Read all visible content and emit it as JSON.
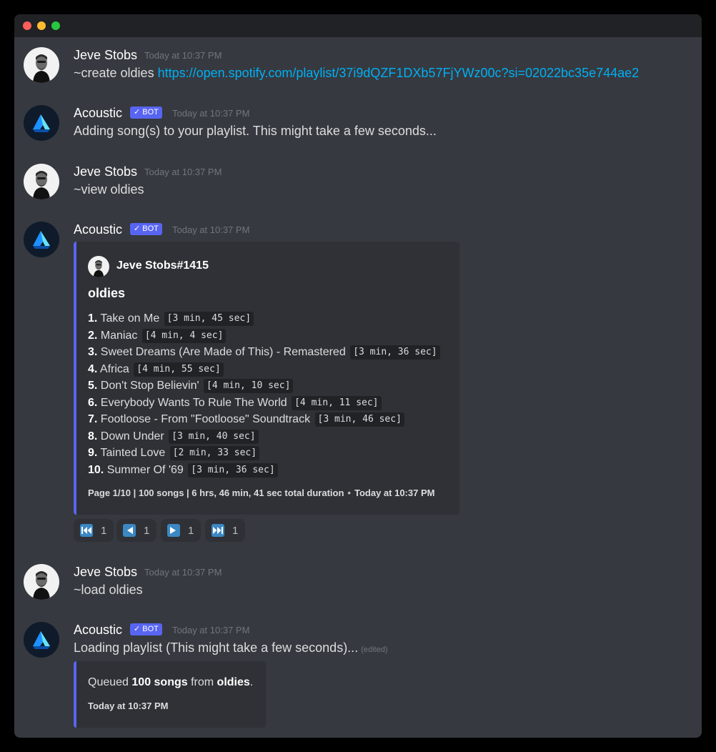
{
  "window": {
    "traffic_lights": [
      "close",
      "minimize",
      "maximize"
    ]
  },
  "users": {
    "jeve": {
      "name": "Jeve Stobs"
    },
    "acoustic": {
      "name": "Acoustic",
      "badge": "✓ BOT",
      "badge_color": "#5865f2"
    }
  },
  "messages": [
    {
      "author": "Jeve Stobs",
      "timestamp": "Today at 10:37 PM",
      "command": "~create oldies",
      "link": "https://open.spotify.com/playlist/37i9dQZF1DXb57FjYWz00c?si=02022bc35e744ae2"
    },
    {
      "author": "Acoustic",
      "badge": "✓ BOT",
      "timestamp": "Today at 10:37 PM",
      "text": "Adding song(s) to your playlist. This might take a few seconds..."
    },
    {
      "author": "Jeve Stobs",
      "timestamp": "Today at 10:37 PM",
      "text": "~view oldies"
    },
    {
      "author": "Acoustic",
      "badge": "✓ BOT",
      "timestamp": "Today at 10:37 PM"
    },
    {
      "author": "Jeve Stobs",
      "timestamp": "Today at 10:37 PM",
      "text": "~load oldies"
    },
    {
      "author": "Acoustic",
      "badge": "✓ BOT",
      "timestamp": "Today at 10:37 PM",
      "text": "Loading playlist (This might take a few seconds)...",
      "edited": "(edited)"
    }
  ],
  "playlist_embed": {
    "author": "Jeve Stobs#1415",
    "title": "oldies",
    "tracks": [
      {
        "num": "1.",
        "title": "Take on Me",
        "duration": "[3 min, 45 sec]"
      },
      {
        "num": "2.",
        "title": "Maniac",
        "duration": "[4 min, 4 sec]"
      },
      {
        "num": "3.",
        "title": "Sweet Dreams (Are Made of This) - Remastered",
        "duration": "[3 min, 36 sec]"
      },
      {
        "num": "4.",
        "title": "Africa",
        "duration": "[4 min, 55 sec]"
      },
      {
        "num": "5.",
        "title": "Don't Stop Believin'",
        "duration": "[4 min, 10 sec]"
      },
      {
        "num": "6.",
        "title": "Everybody Wants To Rule The World",
        "duration": "[4 min, 11 sec]"
      },
      {
        "num": "7.",
        "title": "Footloose - From \"Footloose\" Soundtrack",
        "duration": "[3 min, 46 sec]"
      },
      {
        "num": "8.",
        "title": "Down Under",
        "duration": "[3 min, 40 sec]"
      },
      {
        "num": "9.",
        "title": "Tainted Love",
        "duration": "[2 min, 33 sec]"
      },
      {
        "num": "10.",
        "title": "Summer Of '69",
        "duration": "[3 min, 36 sec]"
      }
    ],
    "footer": "Page 1/10 | 100 songs | 6 hrs, 46 min, 41 sec total duration",
    "footer_sep": "•",
    "footer_time": "Today at 10:37 PM"
  },
  "reactions": [
    {
      "icon": "first-page-icon",
      "count": "1"
    },
    {
      "icon": "previous-page-icon",
      "count": "1"
    },
    {
      "icon": "next-page-icon",
      "count": "1"
    },
    {
      "icon": "last-page-icon",
      "count": "1"
    }
  ],
  "queued_embed": {
    "prefix": "Queued ",
    "count": "100 songs",
    "middle": " from ",
    "playlist": "oldies",
    "suffix": ".",
    "time": "Today at 10:37 PM"
  }
}
